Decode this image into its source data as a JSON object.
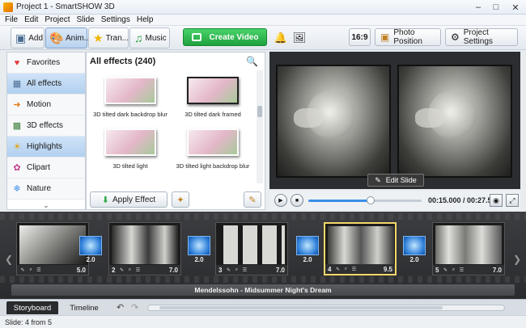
{
  "window": {
    "title": "Project 1 - SmartSHOW 3D"
  },
  "menu": [
    "File",
    "Edit",
    "Project",
    "Slide",
    "Settings",
    "Help"
  ],
  "toolbar": {
    "tabs": [
      {
        "label": "Add",
        "icon": "add-photos-icon"
      },
      {
        "label": "Anim...",
        "icon": "palette-icon"
      },
      {
        "label": "Tran...",
        "icon": "star-icon"
      },
      {
        "label": "Music",
        "icon": "music-note-icon"
      }
    ],
    "create_video": "Create Video",
    "aspect": "16:9",
    "photo_position": "Photo Position",
    "project_settings": "Project Settings"
  },
  "categories": [
    {
      "label": "Favorites",
      "icon": "heart-icon"
    },
    {
      "label": "All effects",
      "icon": "grid-icon"
    },
    {
      "label": "Motion",
      "icon": "arrow-right-icon"
    },
    {
      "label": "3D effects",
      "icon": "cube-icon"
    },
    {
      "label": "Highlights",
      "icon": "sun-icon"
    },
    {
      "label": "Clipart",
      "icon": "clipart-icon"
    },
    {
      "label": "Nature",
      "icon": "snowflake-icon"
    }
  ],
  "effects": {
    "title": "All effects (240)",
    "items": [
      {
        "label": "3D tilted dark backdrop blur"
      },
      {
        "label": "3D tilted dark framed"
      },
      {
        "label": "3D tilted light"
      },
      {
        "label": "3D tilted light backdrop blur"
      }
    ],
    "apply_label": "Apply Effect"
  },
  "preview": {
    "edit_slide": "Edit Slide"
  },
  "playback": {
    "timecode": "00:15.000 / 00:27.500",
    "progress": 0.55
  },
  "timeline": {
    "slides": [
      {
        "num": "1",
        "duration": "5.0"
      },
      {
        "num": "2",
        "duration": "7.0"
      },
      {
        "num": "3",
        "duration": "7.0"
      },
      {
        "num": "4",
        "duration": "9.5"
      },
      {
        "num": "5",
        "duration": "7.0"
      }
    ],
    "transitions": [
      "2.0",
      "2.0",
      "2.0",
      "2.0"
    ],
    "music": "Mendelssohn - Midsummer Night's Dream"
  },
  "bottom_tabs": [
    "Storyboard",
    "Timeline"
  ],
  "status": "Slide: 4 from 5"
}
